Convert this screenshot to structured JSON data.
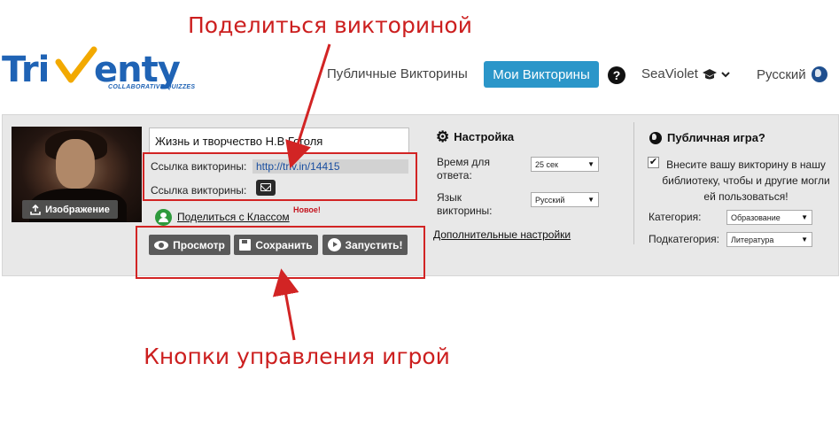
{
  "annotations": {
    "share": "Поделиться викториной",
    "controls": "Кнопки управления игрой"
  },
  "header": {
    "logo_text": "TriVenty",
    "logo_tagline": "COLLABORATIVE QUIZZES",
    "nav_public": "Публичные Викторины",
    "nav_my": "Мои Викторины",
    "help": "?",
    "user": "SeaViolet",
    "language": "Русский"
  },
  "quiz": {
    "image_button": "Изображение",
    "title": "Жизнь и творчество Н.В Гоголя",
    "link_label": "Ссылка викторины:",
    "link_value": "http://triv.in/14415",
    "link_label_2": "Ссылка викторины:",
    "share_link": "Поделиться с Классом",
    "new_badge": "Новое!",
    "buttons": {
      "preview": "Просмотр",
      "save": "Сохранить",
      "run": "Запустить!"
    }
  },
  "settings": {
    "title": "Настройка",
    "answer_time_label": "Время для ответа:",
    "answer_time_value": "25 сек",
    "quiz_language_label": "Язык викторины:",
    "quiz_language_value": "Русский",
    "more_settings": "Дополнительные настройки"
  },
  "public": {
    "title": "Публичная игра?",
    "checked": true,
    "description": "Внесите вашу викторину в нашу библиотеку, чтобы и другие могли ей пользоваться!",
    "category_label": "Категория:",
    "category_value": "Образование",
    "subcategory_label": "Подкатегория:",
    "subcategory_value": "Литература"
  },
  "colors": {
    "annotation_red": "#cc1f1f",
    "brand_blue": "#1f63b5",
    "nav_active": "#2b96c9",
    "logo_check": "#f2a900",
    "panel_bg": "#e8e8e8"
  }
}
